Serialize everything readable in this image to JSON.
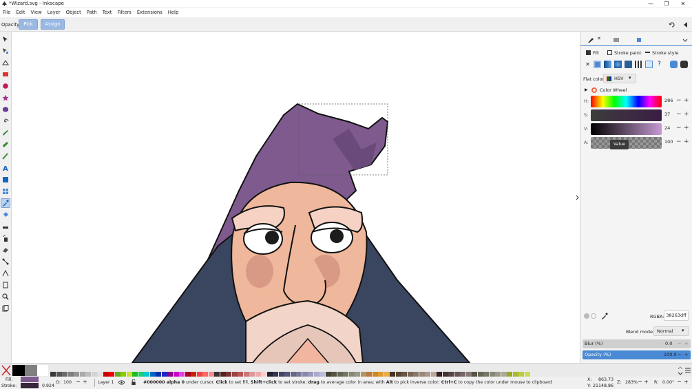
{
  "window": {
    "title": "*Wizard.svg - Inkscape",
    "minimize": "—",
    "maximize": "❐",
    "close": "✕"
  },
  "menu": [
    "File",
    "Edit",
    "View",
    "Layer",
    "Object",
    "Path",
    "Text",
    "Filters",
    "Extensions",
    "Help"
  ],
  "toolctrl": {
    "opacity_label": "Opacity",
    "pick_label": "Pick",
    "assign_label": "Assign"
  },
  "fill_panel": {
    "tabs": {
      "fill": "Fill",
      "stroke_paint": "Stroke paint",
      "stroke_style": "Stroke style"
    },
    "flat_color_label": "Flat color",
    "mode_select": "HSV",
    "color_wheel_label": "Color Wheel",
    "sliders": [
      {
        "label": "H:",
        "value": "286"
      },
      {
        "label": "S:",
        "value": "37"
      },
      {
        "label": "V:",
        "value": "24"
      },
      {
        "label": "A:",
        "value": "100"
      }
    ],
    "tooltip": "Value",
    "rgba_label": "RGBA:",
    "rgba_value": "38263dff",
    "blend_label": "Blend mode:",
    "blend_value": "Normal",
    "blur_label": "Blur (%)",
    "blur_value": "0.0",
    "opacity_label": "Opacity (%)",
    "opacity_value": "100.0"
  },
  "status": {
    "fill_label": "Fill:",
    "stroke_label": "Stroke:",
    "stroke_width": "0.924",
    "opacity_label": "O:",
    "opacity_value": "100",
    "layer": "Layer 1",
    "message_bold1": "#000000 alpha 0",
    "message_rest1": " under cursor. ",
    "message_bold2": "Click",
    "message_rest2": " to set fill, ",
    "message_bold3": "Shift+click",
    "message_rest3": " to set stroke; ",
    "message_bold4": "drag",
    "message_rest4": " to average color in area; with ",
    "message_bold5": "Alt",
    "message_rest5": " to pick inverse color; ",
    "message_bold6": "Ctrl+C",
    "message_rest6": " to copy the color under mouse to clipboard",
    "x_label": "X:",
    "x_value": "863.73",
    "y_label": "Y:",
    "y_value": "21148.86",
    "zoom_label": "Z:",
    "zoom_value": "283%",
    "rot_label": "R:",
    "rot_value": "0.00°"
  },
  "colors": {
    "hat": "#7e5a8e",
    "hat_dark": "#6a4a7a",
    "robe": "#3a4560",
    "skin": "#efb79b",
    "skin_shadow": "#d99a85",
    "beard": "#f2d5c8",
    "fill_swatch": "#7e5a8e",
    "stroke_swatch": "#38263d",
    "accent_blue": "#4a8ad4"
  }
}
